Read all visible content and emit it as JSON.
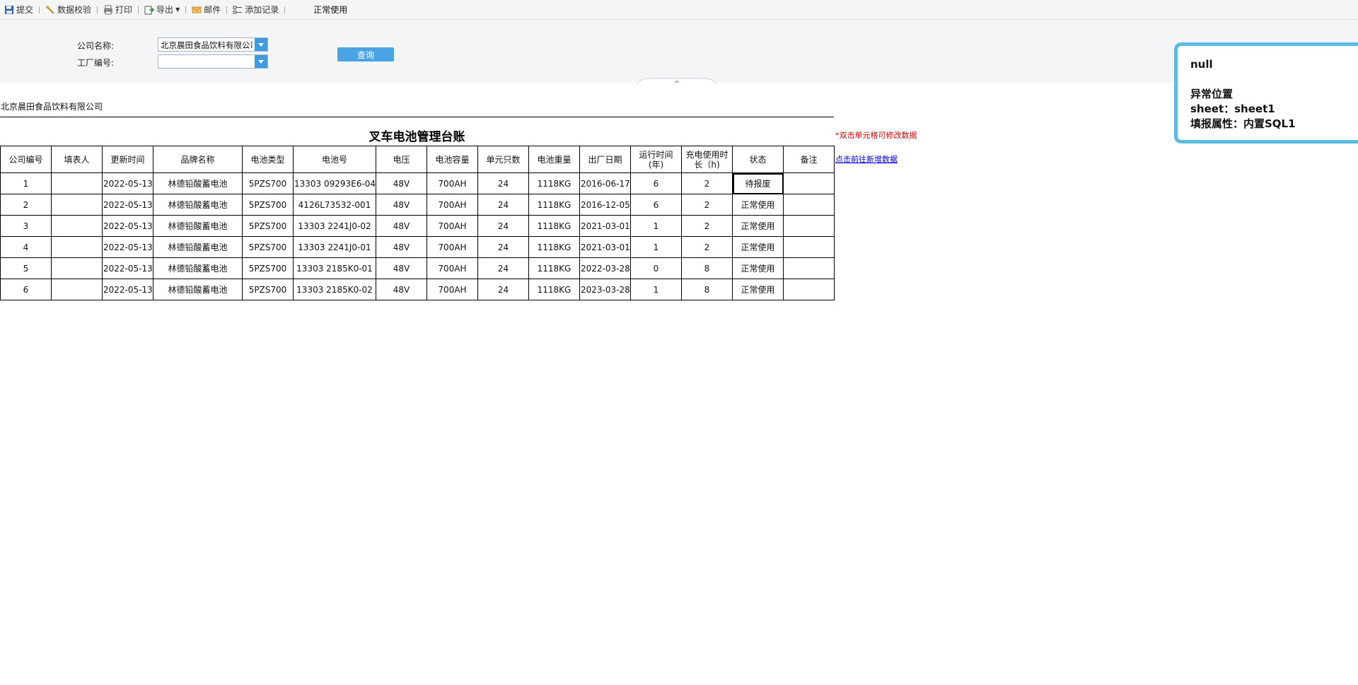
{
  "toolbar": {
    "buttons": [
      {
        "label": "提交",
        "icon": "save-icon"
      },
      {
        "label": "数据校验",
        "icon": "validate-icon"
      },
      {
        "label": "打印",
        "icon": "print-icon"
      },
      {
        "label": "导出",
        "icon": "export-icon"
      },
      {
        "label": "邮件",
        "icon": "mail-icon"
      },
      {
        "label": "添加记录",
        "icon": "add-record-icon"
      }
    ],
    "status_text": "正常使用"
  },
  "params": {
    "company_label": "公司名称:",
    "company_value": "北京晨田食品饮料有限公司",
    "factory_label": "工厂编号:",
    "factory_value": "",
    "query_label": "查询"
  },
  "report": {
    "company_name": "北京晨田食品饮料有限公司",
    "title": "叉车电池管理台账",
    "edit_hint": "*双击单元格可修改数据",
    "add_link": "点击前往新增数据",
    "headers": [
      "公司编号",
      "填表人",
      "更新时间",
      "品牌名称",
      "电池类型",
      "电池号",
      "电压",
      "电池容量",
      "单元只数",
      "电池重量",
      "出厂日期",
      "运行时间(年)",
      "充电使用时长（h)",
      "状态",
      "备注"
    ],
    "rows": [
      [
        "1",
        "",
        "2022-05-13",
        "林德铅酸蓄电池",
        "5PZS700",
        "13303 09293E6-04",
        "48V",
        "700AH",
        "24",
        "1118KG",
        "2016-06-17",
        "6",
        "2",
        "待报废",
        ""
      ],
      [
        "2",
        "",
        "2022-05-13",
        "林德铅酸蓄电池",
        "5PZS700",
        "4126L73532-001",
        "48V",
        "700AH",
        "24",
        "1118KG",
        "2016-12-05",
        "6",
        "2",
        "正常使用",
        ""
      ],
      [
        "3",
        "",
        "2022-05-13",
        "林德铅酸蓄电池",
        "5PZS700",
        "13303 2241J0-02",
        "48V",
        "700AH",
        "24",
        "1118KG",
        "2021-03-01",
        "1",
        "2",
        "正常使用",
        ""
      ],
      [
        "4",
        "",
        "2022-05-13",
        "林德铅酸蓄电池",
        "5PZS700",
        "13303 2241J0-01",
        "48V",
        "700AH",
        "24",
        "1118KG",
        "2021-03-01",
        "1",
        "2",
        "正常使用",
        ""
      ],
      [
        "5",
        "",
        "2022-05-13",
        "林德铅酸蓄电池",
        "5PZS700",
        "13303 2185K0-01",
        "48V",
        "700AH",
        "24",
        "1118KG",
        "2022-03-28",
        "0",
        "8",
        "正常使用",
        ""
      ],
      [
        "6",
        "",
        "2022-05-13",
        "林德铅酸蓄电池",
        "5PZS700",
        "13303 2185K0-02",
        "48V",
        "700AH",
        "24",
        "1118KG",
        "2023-03-28",
        "1",
        "8",
        "正常使用",
        ""
      ]
    ]
  },
  "popup": {
    "line1": "null",
    "line2": "异常位置",
    "line3": "sheet：sheet1",
    "line4": "填报属性：内置SQL1"
  },
  "colors": {
    "accent": "#4aa3e3",
    "popup_border": "#5bbbe0",
    "hint_red": "#e00000",
    "link_blue": "#0000ee"
  }
}
